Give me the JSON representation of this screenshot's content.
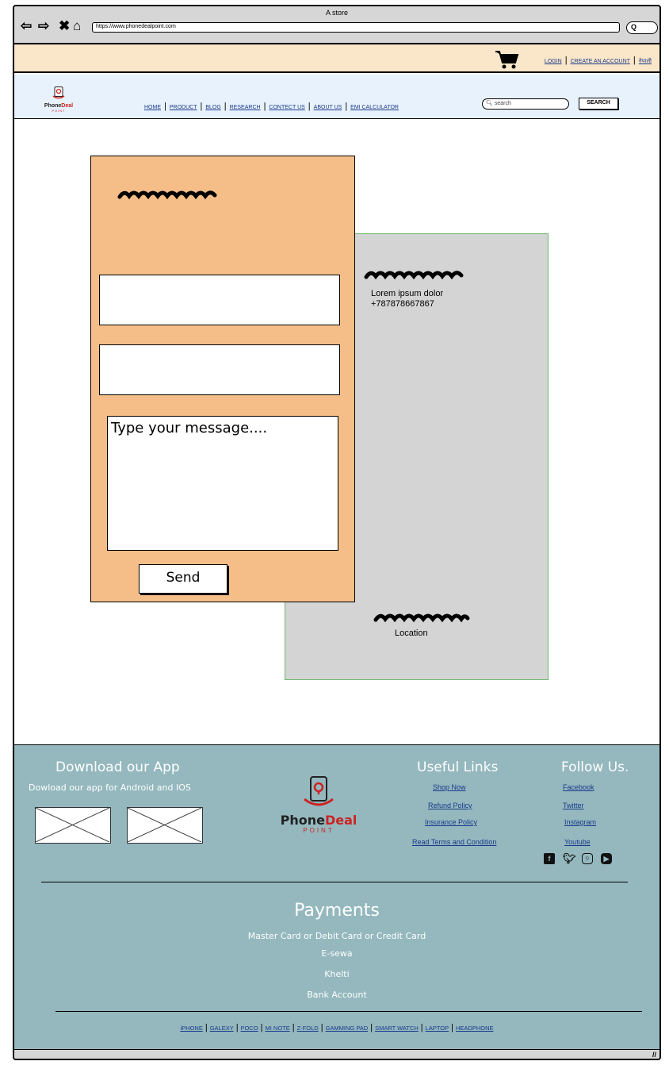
{
  "window": {
    "title": "A store",
    "url": "https://www.phonedealpoint.com",
    "search_glyph": "Q"
  },
  "topbar": {
    "links": [
      "LOGIN",
      "CREATE AN ACCOUNT",
      "नेपाली"
    ]
  },
  "header": {
    "logo": {
      "brand_a": "Phone",
      "brand_b": "Deal",
      "sub": "POINT"
    },
    "nav": [
      "HOME",
      "PRODUCT",
      "BLOG",
      "RESEARCH",
      "CONTECT US",
      "ABOUT US",
      "EMI CALCULATOR"
    ],
    "search_placeholder": "search",
    "search_button": "SEARCH"
  },
  "contact_form": {
    "message_placeholder": "Type your message....",
    "send_label": "Send"
  },
  "contact_info": {
    "line1": "Lorem ipsum dolor",
    "phone": "+787878667867",
    "location_label": "Location"
  },
  "footer": {
    "app_title": "Download our App",
    "app_sub": "Dowload our app for Android and IOS",
    "logo": {
      "brand_a": "Phone",
      "brand_b": "Deal",
      "sub": "POINT"
    },
    "useful_title": "Useful Links",
    "useful_links": [
      "Shop Now",
      "Refund Policy",
      "Insurance Policy",
      "Read Terms and Condition"
    ],
    "follow_title": "Follow Us.",
    "follow_links": [
      "Facebook",
      "Twitter",
      "Instagram",
      "Youtube"
    ],
    "social_icons": [
      "facebook-icon",
      "twitter-icon",
      "instagram-icon",
      "youtube-icon"
    ],
    "payments_title": "Payments",
    "payments": [
      "Master Card or Debit Card or Credit Card",
      "E-sewa",
      "Khelti",
      "Bank Account"
    ],
    "bottom_nav": [
      "iPHONE",
      "GALEXY",
      "POCO",
      "MI NOTE",
      "Z-FOLD",
      "GAMMING PAD",
      "SMART WATCH",
      "LAPTOP",
      "HEADPHONE"
    ]
  }
}
